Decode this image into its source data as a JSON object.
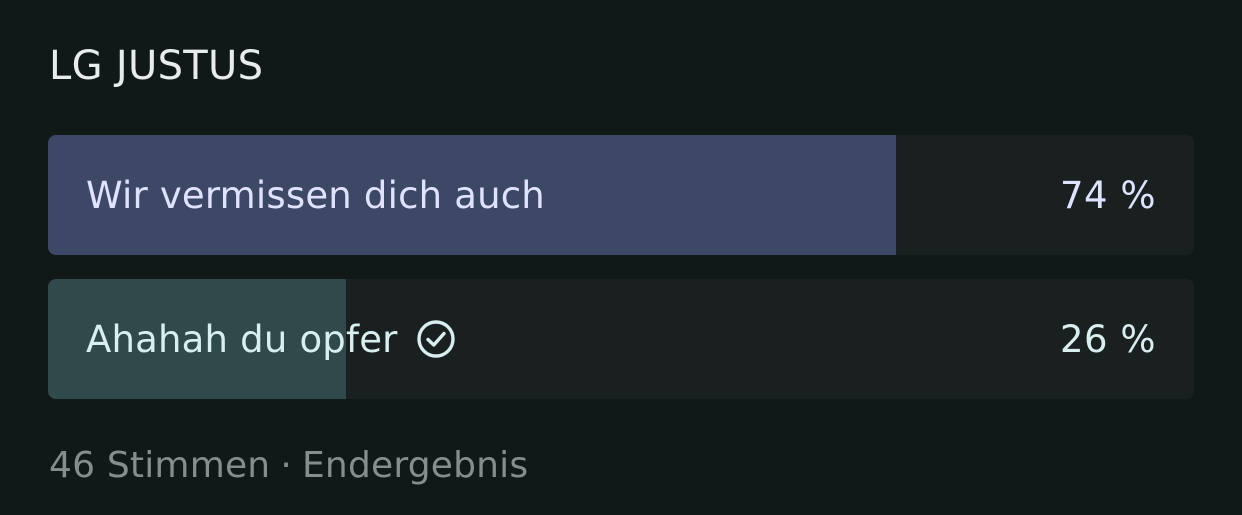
{
  "poll": {
    "question": "LG JUSTUS",
    "options": [
      {
        "label": "Wir vermissen dich auch",
        "percent_label": "74 %",
        "percent": 74,
        "fill_color": "#3c4866",
        "text_color": "#dfe3ff",
        "selected": false
      },
      {
        "label": "Ahahah du opfer",
        "percent_label": "26 %",
        "percent": 26,
        "fill_color": "#304a4c",
        "text_color": "#d9eeee",
        "selected": true,
        "icon": "check-circle-icon"
      }
    ],
    "footer": {
      "votes": "46 Stimmen",
      "separator": "·",
      "status": "Endergebnis"
    }
  },
  "colors": {
    "background": "#111818",
    "track": "#1a2020",
    "question_text": "#e8ecec",
    "footer_text": "#858d8d"
  }
}
